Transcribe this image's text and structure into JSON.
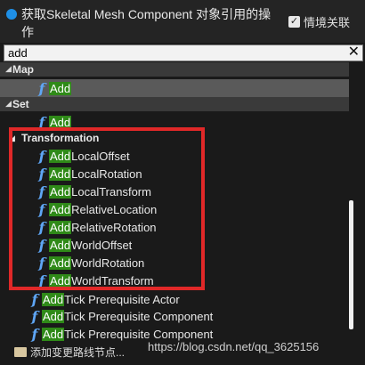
{
  "header": {
    "title": "获取Skeletal Mesh Component 对象引用的操作",
    "context_label": "情境关联",
    "context_checked": true
  },
  "search": {
    "value": "add",
    "clear_label": "✕"
  },
  "map_section": {
    "label": "Map",
    "items": [
      {
        "hl": "Add",
        "rest": ""
      }
    ]
  },
  "set_section": {
    "label": "Set",
    "items": [
      {
        "hl": "Add",
        "rest": ""
      }
    ]
  },
  "transformation_section": {
    "label": "Transformation",
    "items": [
      {
        "hl": "Add",
        "rest": "LocalOffset"
      },
      {
        "hl": "Add",
        "rest": "LocalRotation"
      },
      {
        "hl": "Add",
        "rest": "LocalTransform"
      },
      {
        "hl": "Add",
        "rest": "RelativeLocation"
      },
      {
        "hl": "Add",
        "rest": "RelativeRotation"
      },
      {
        "hl": "Add",
        "rest": "WorldOffset"
      },
      {
        "hl": "Add",
        "rest": "WorldRotation"
      },
      {
        "hl": "Add",
        "rest": "WorldTransform"
      }
    ]
  },
  "other_items": [
    {
      "hl": "Add",
      "rest": " Tick Prerequisite Actor"
    },
    {
      "hl": "Add",
      "rest": " Tick Prerequisite Component"
    },
    {
      "hl": "Add",
      "rest": " Tick Prerequisite Component"
    }
  ],
  "footer": {
    "label": "添加变更路线节点..."
  },
  "watermark": "https://blog.csdn.net/qq_3625156",
  "colors": {
    "accent": "#1e8fe6",
    "highlight": "#2f8a18",
    "function_icon": "#5fa6f5",
    "annotation": "#e02828"
  }
}
